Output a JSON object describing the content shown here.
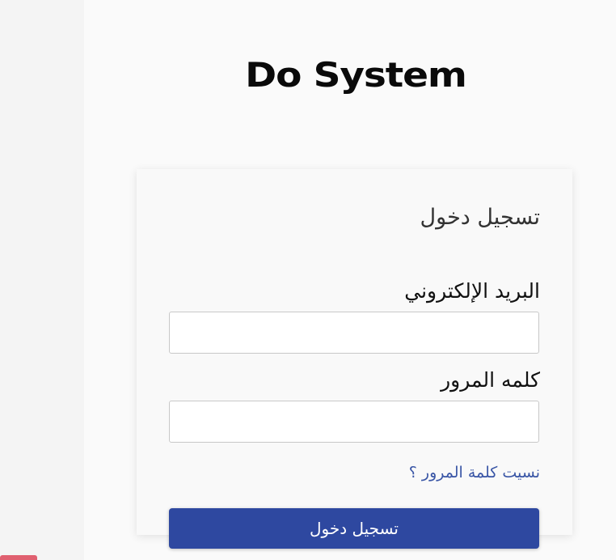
{
  "brand": {
    "name": "Do System"
  },
  "login_card": {
    "title": "تسجيل دخول",
    "email_label": "البريد الإلكتروني",
    "email_value": "",
    "password_label": "كلمه المرور",
    "password_value": "",
    "forgot_password_link": "نسيت كلمة المرور ؟",
    "submit_label": "تسجيل دخول"
  },
  "colors": {
    "primary_button": "#2e48a0",
    "link": "#3a56a6",
    "background": "#fafafa"
  }
}
